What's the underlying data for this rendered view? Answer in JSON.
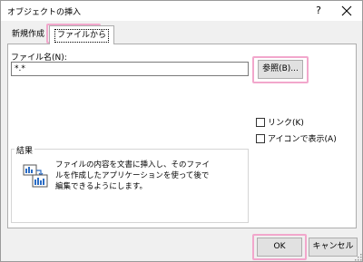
{
  "dialog": {
    "title": "オブジェクトの挿入",
    "help": "?",
    "close_icon": "close-icon"
  },
  "tabs": [
    {
      "label": "新規作成",
      "selected": false
    },
    {
      "label": "ファイルから",
      "selected": true
    }
  ],
  "file": {
    "label": "ファイル名(N):",
    "value": "*.*",
    "browse_label": "参照(B)..."
  },
  "options": {
    "link_label": "リンク(K)",
    "link_checked": false,
    "icon_label": "アイコンで表示(A)",
    "icon_checked": false
  },
  "result": {
    "title": "結果",
    "text": "ファイルの内容を文書に挿入し、そのファイルを作成したアプリケーションを使って後で編集できるようにします。",
    "icon": "insert-object-icon"
  },
  "buttons": {
    "ok_label": "OK",
    "cancel_label": "キャンセル"
  },
  "colors": {
    "highlight": "#f2a7cc",
    "panel_bg": "#ffffff",
    "dialog_bg": "#f0f0f0"
  }
}
